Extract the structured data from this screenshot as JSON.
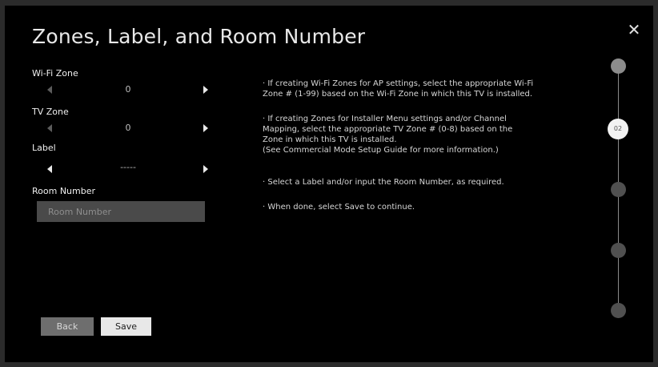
{
  "title": "Zones, Label, and Room Number",
  "fields": {
    "wifi_zone": {
      "label": "Wi-Fi Zone",
      "value": "0"
    },
    "tv_zone": {
      "label": "TV Zone",
      "value": "0"
    },
    "label": {
      "label": "Label",
      "value": "-----"
    },
    "room_number": {
      "label": "Room Number",
      "placeholder": "Room Number",
      "value": ""
    }
  },
  "instructions": [
    "· If creating Wi-Fi Zones for AP settings, select the appropriate Wi-Fi\n  Zone # (1-99) based on the Wi-Fi Zone in which this TV is installed.",
    "· If creating Zones for Installer Menu settings and/or Channel\n  Mapping, select the appropriate TV Zone # (0-8) based on the\n  Zone in which this TV is installed.\n  (See Commercial Mode Setup Guide for more information.)",
    "· Select a Label and/or input the Room Number, as required.",
    "· When done, select Save to continue."
  ],
  "buttons": {
    "back": "Back",
    "save": "Save"
  },
  "steps": {
    "active_label": "02"
  },
  "icons": {
    "close": "close-icon",
    "left_arrow": "triangle-left-icon",
    "right_arrow": "triangle-right-icon"
  },
  "colors": {
    "background": "#000000",
    "input_bg": "#4a4a4a",
    "save_bg": "#e8e8e8",
    "back_bg": "#6e6e6e"
  }
}
